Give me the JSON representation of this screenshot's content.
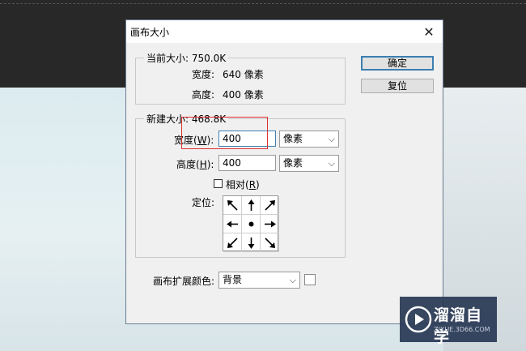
{
  "dialog": {
    "title": "画布大小",
    "close_glyph": "✕",
    "ok_label": "确定",
    "reset_label": "复位"
  },
  "current_size": {
    "legend": "当前大小: 750.0K",
    "width_label": "宽度:",
    "width_value": "640 像素",
    "height_label": "高度:",
    "height_value": "400 像素"
  },
  "new_size": {
    "legend": "新建大小: 468.8K",
    "width_label_pre": "宽度(",
    "width_label_key": "W",
    "width_label_post": "):",
    "width_value": "400",
    "width_unit": "像素",
    "height_label_pre": "高度(",
    "height_label_key": "H",
    "height_label_post": "):",
    "height_value": "400",
    "height_unit": "像素",
    "relative_label_pre": "相对(",
    "relative_label_key": "R",
    "relative_label_post": ")",
    "relative_checked": false,
    "anchor_label": "定位:",
    "anchor_icons": [
      "arrow-up-left-icon",
      "arrow-up-icon",
      "arrow-up-right-icon",
      "arrow-left-icon",
      "anchor-center-icon",
      "arrow-right-icon",
      "arrow-down-left-icon",
      "arrow-down-icon",
      "arrow-down-right-icon"
    ]
  },
  "extension": {
    "label": "画布扩展颜色:",
    "value": "背景"
  },
  "watermark": {
    "name": "溜溜自学",
    "url": "ZIXUE.3D66.COM"
  },
  "colors": {
    "focus_border": "#3c7fb1",
    "highlight_box": "#e03030",
    "watermark_bg": "#283854"
  }
}
